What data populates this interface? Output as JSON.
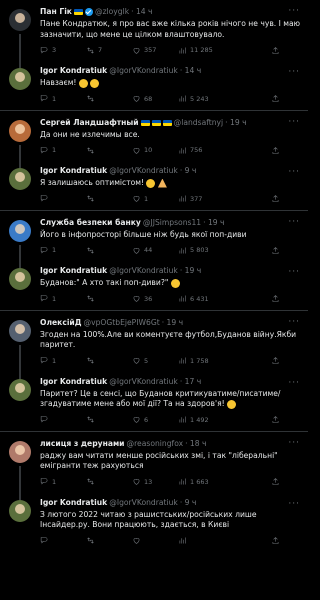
{
  "tweets": [
    {
      "name": "Пан Гік",
      "flag": true,
      "verified": true,
      "handle": "@zloyglk",
      "time": "· 14 ч",
      "text": "Пане Кондратюк, я про вас вже кілька років нічого не чув. І маю зазначити, що мене це цілком влаштовувало.",
      "replies": "3",
      "retweets": "7",
      "likes": "357",
      "views": "11 285",
      "avatarColor": "#2b2f34"
    },
    {
      "name": "Igor Kondratiuk",
      "handle": "@IgorVKondratiuk",
      "time": "· 14 ч",
      "text": "Навзаєм!",
      "emoji": [
        "smile",
        "smile"
      ],
      "replies": "1",
      "retweets": "",
      "likes": "68",
      "views": "5 243",
      "avatarColor": "#5a6f3c"
    },
    {
      "name": "Сергей Ландшафтный",
      "flag": true,
      "flags": 3,
      "handle": "@landsaftnyj",
      "time": "· 19 ч",
      "text": "Да они не излечимы все.",
      "replies": "1",
      "retweets": "",
      "likes": "10",
      "views": "756",
      "avatarColor": "#b86b3a"
    },
    {
      "name": "Igor Kondratiuk",
      "handle": "@IgorVKondratiuk",
      "time": "· 9 ч",
      "text": "Я залишаюсь оптимістом!",
      "emoji": [
        "smile",
        "pray"
      ],
      "replies": "",
      "retweets": "",
      "likes": "1",
      "views": "377",
      "avatarColor": "#5a6f3c"
    },
    {
      "name": "Служба безпеки банку",
      "handle": "@JJSimpsons11",
      "time": "· 19 ч",
      "text": "Його в інфопросторі більше ніж будь якої поп-диви",
      "replies": "1",
      "retweets": "",
      "likes": "44",
      "views": "5 803",
      "avatarColor": "#3a7bc8"
    },
    {
      "name": "Igor Kondratiuk",
      "handle": "@IgorVKondratiuk",
      "time": "· 19 ч",
      "text": "Буданов:\" А хто такі поп-диви?\"",
      "emoji": [
        "smile"
      ],
      "replies": "1",
      "retweets": "",
      "likes": "36",
      "views": "6 431",
      "avatarColor": "#5a6f3c"
    },
    {
      "name": "ОлексійД",
      "handle": "@vpOGtbEjePIW6Gt",
      "time": "· 19 ч",
      "text": "Згоден на 100%.Але ви коментуєте футбол,Буданов війну.Якби паритет.",
      "replies": "1",
      "retweets": "",
      "likes": "5",
      "views": "1 758",
      "avatarColor": "#556070"
    },
    {
      "name": "Igor Kondratiuk",
      "handle": "@IgorVKondratiuk",
      "time": "· 17 ч",
      "text": "Паритет? Це в сенсі, що Буданов критикуватиме/писатиме/згадуватиме мене або мої дії? Та на здоров'я!",
      "emoji": [
        "smile"
      ],
      "replies": "",
      "retweets": "",
      "likes": "6",
      "views": "1 492",
      "avatarColor": "#5a6f3c"
    },
    {
      "name": "лисиця з дерунами",
      "handle": "@reasoningfox",
      "time": "· 18 ч",
      "text": "раджу вам читати менше російських змі, і так \"ліберальні\" емігранти теж рахуються",
      "replies": "1",
      "retweets": "",
      "likes": "13",
      "views": "1 663",
      "avatarColor": "#b07a6a"
    },
    {
      "name": "Igor Kondratiuk",
      "handle": "@IgorVKondratiuk",
      "time": "· 9 ч",
      "text": "З лютого 2022 читаю з рашистських/російських лише Інсайдер.ру. Вони працюють, здається, в Києві",
      "replies": "",
      "retweets": "",
      "likes": "",
      "views": "",
      "avatarColor": "#5a6f3c"
    }
  ],
  "threadLineColor": "#333639",
  "icons": {
    "reply": "reply-icon",
    "retweet": "retweet-icon",
    "like": "heart-icon",
    "views": "views-icon",
    "share": "share-icon",
    "more": "more-icon"
  }
}
